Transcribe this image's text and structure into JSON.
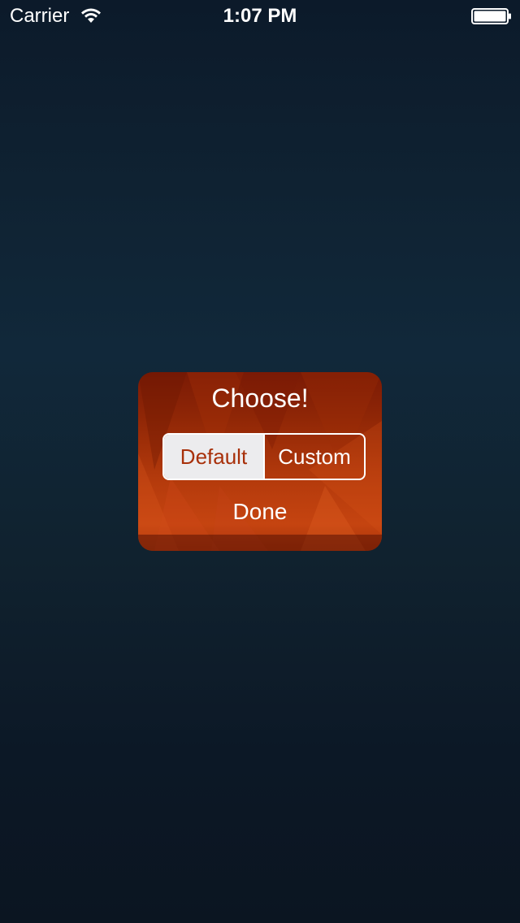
{
  "status_bar": {
    "carrier": "Carrier",
    "time": "1:07 PM",
    "wifi_icon": "wifi-icon",
    "battery_icon": "battery-icon"
  },
  "dialog": {
    "title": "Choose!",
    "segments": [
      {
        "label": "Default",
        "selected": true
      },
      {
        "label": "Custom",
        "selected": false
      }
    ],
    "done_label": "Done",
    "accent_color": "#a8300a",
    "background_color": "#b43a0c"
  }
}
